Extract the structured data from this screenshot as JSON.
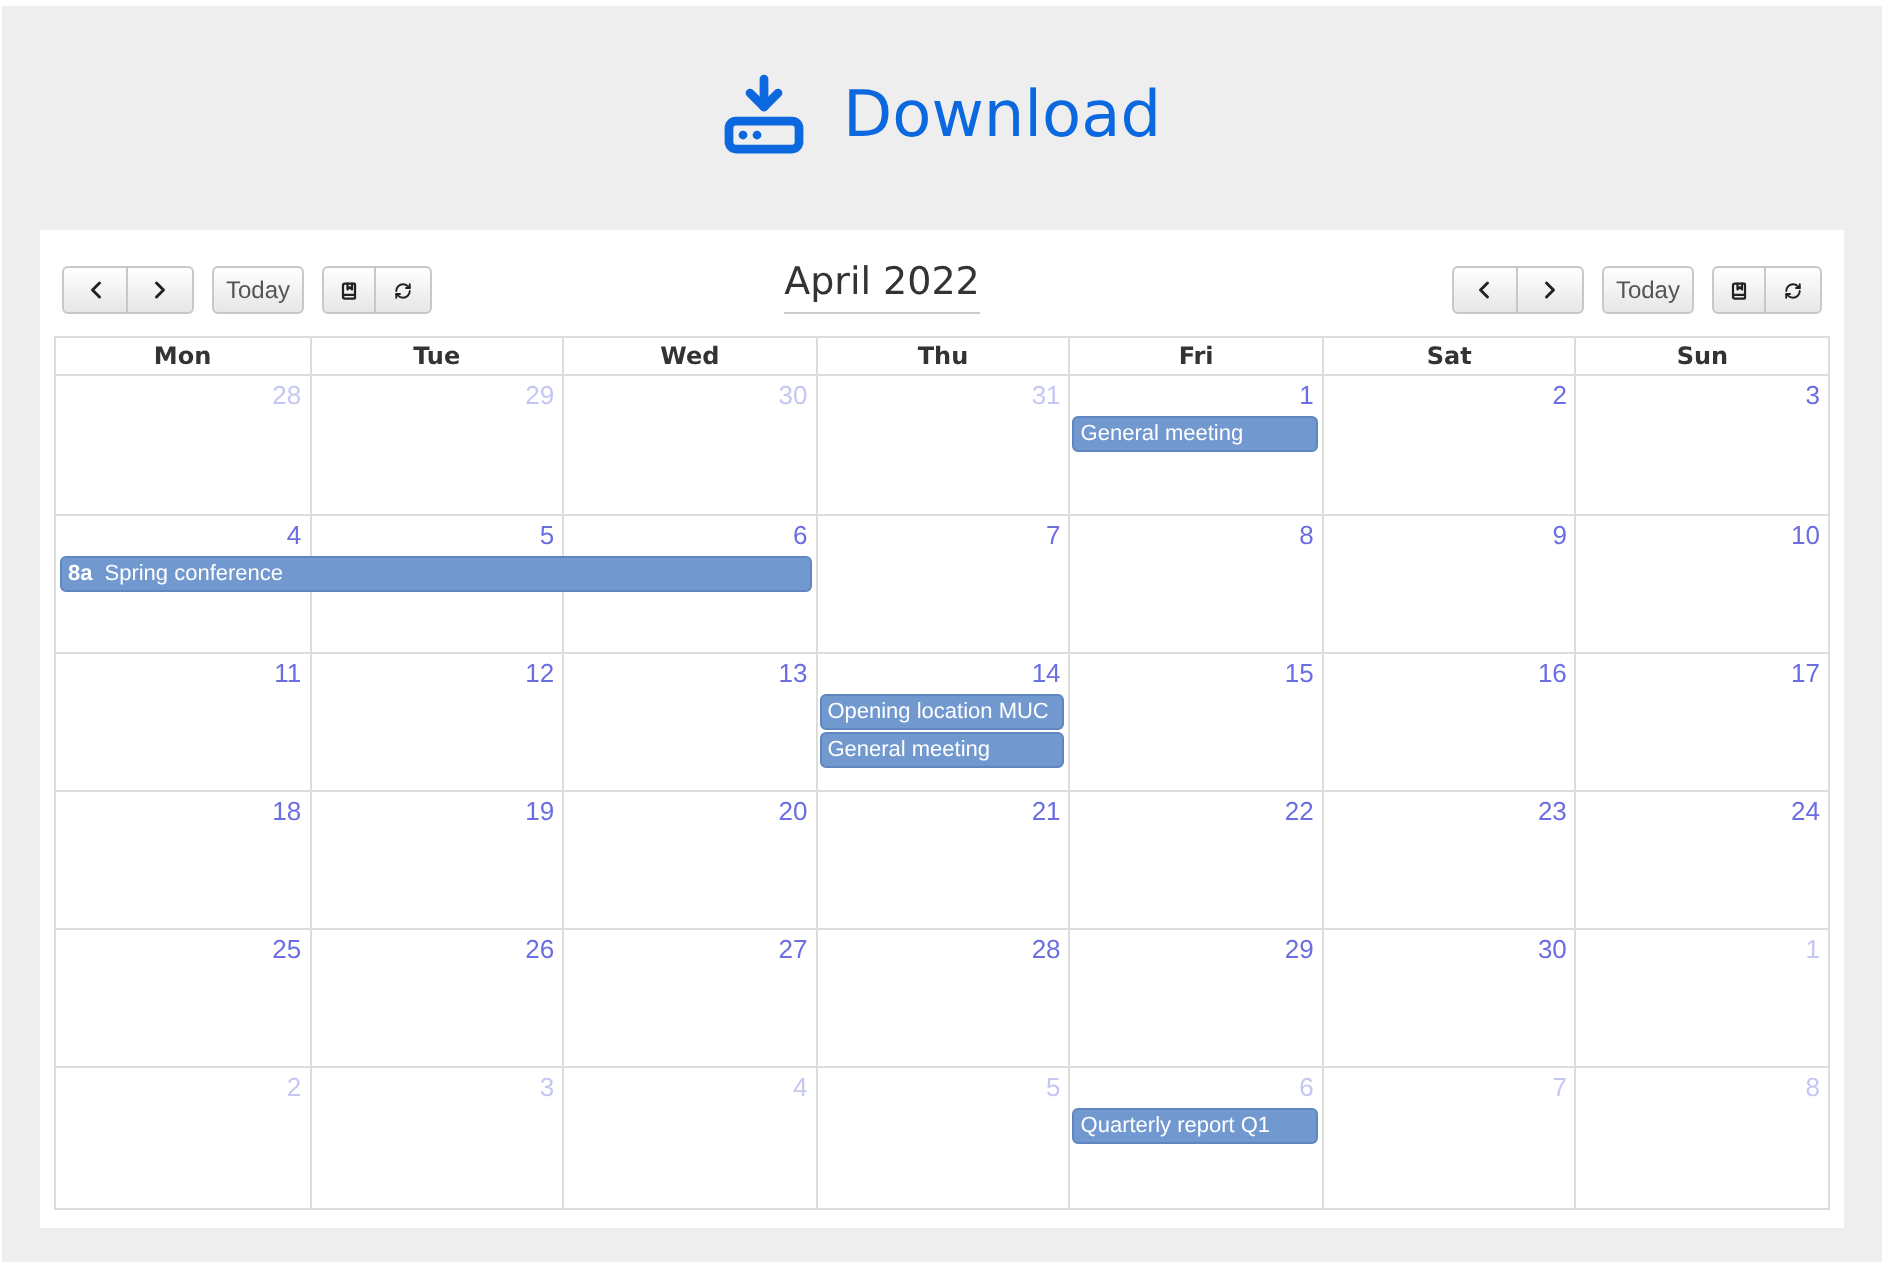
{
  "header": {
    "label": "Download"
  },
  "toolbars": [
    {
      "today": "Today"
    },
    {
      "today": "Today"
    }
  ],
  "calendar": {
    "title": "April 2022",
    "weekdays": [
      "Mon",
      "Tue",
      "Wed",
      "Thu",
      "Fri",
      "Sat",
      "Sun"
    ],
    "weeks": [
      {
        "days": [
          {
            "number": "28",
            "other_month": true
          },
          {
            "number": "29",
            "other_month": true
          },
          {
            "number": "30",
            "other_month": true
          },
          {
            "number": "31",
            "other_month": true
          },
          {
            "number": "1",
            "other_month": false,
            "events": [
              {
                "title": "General meeting"
              }
            ]
          },
          {
            "number": "2",
            "other_month": false
          },
          {
            "number": "3",
            "other_month": false
          }
        ]
      },
      {
        "days": [
          {
            "number": "4",
            "other_month": false,
            "events": [
              {
                "time": "8a",
                "title": "Spring conference"
              }
            ]
          },
          {
            "number": "5",
            "other_month": false
          },
          {
            "number": "6",
            "other_month": false
          },
          {
            "number": "7",
            "other_month": false
          },
          {
            "number": "8",
            "other_month": false
          },
          {
            "number": "9",
            "other_month": false
          },
          {
            "number": "10",
            "other_month": false
          }
        ]
      },
      {
        "days": [
          {
            "number": "11",
            "other_month": false
          },
          {
            "number": "12",
            "other_month": false
          },
          {
            "number": "13",
            "other_month": false
          },
          {
            "number": "14",
            "other_month": false,
            "events": [
              {
                "title": "Opening location MUC"
              },
              {
                "title": "General meeting"
              }
            ]
          },
          {
            "number": "15",
            "other_month": false
          },
          {
            "number": "16",
            "other_month": false
          },
          {
            "number": "17",
            "other_month": false
          }
        ]
      },
      {
        "days": [
          {
            "number": "18",
            "other_month": false
          },
          {
            "number": "19",
            "other_month": false
          },
          {
            "number": "20",
            "other_month": false
          },
          {
            "number": "21",
            "other_month": false
          },
          {
            "number": "22",
            "other_month": false
          },
          {
            "number": "23",
            "other_month": false
          },
          {
            "number": "24",
            "other_month": false
          }
        ]
      },
      {
        "days": [
          {
            "number": "25",
            "other_month": false
          },
          {
            "number": "26",
            "other_month": false
          },
          {
            "number": "27",
            "other_month": false
          },
          {
            "number": "28",
            "other_month": false
          },
          {
            "number": "29",
            "other_month": false
          },
          {
            "number": "30",
            "other_month": false
          },
          {
            "number": "1",
            "other_month": true
          }
        ]
      },
      {
        "days": [
          {
            "number": "2",
            "other_month": true
          },
          {
            "number": "3",
            "other_month": true
          },
          {
            "number": "4",
            "other_month": true
          },
          {
            "number": "5",
            "other_month": true
          },
          {
            "number": "6",
            "other_month": true,
            "events": [
              {
                "title": "Quarterly report Q1"
              }
            ]
          },
          {
            "number": "7",
            "other_month": true
          },
          {
            "number": "8",
            "other_month": true
          }
        ]
      }
    ]
  }
}
